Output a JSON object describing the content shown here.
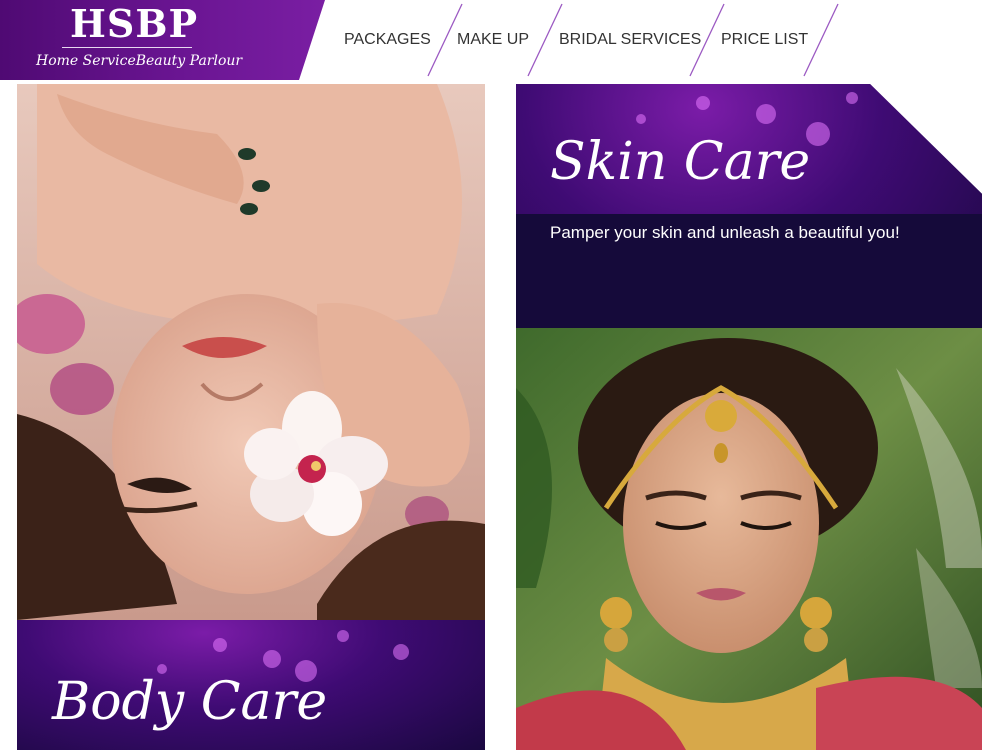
{
  "brand": {
    "logo_text": "HSBP",
    "tagline": "Home ServiceBeauty Parlour",
    "color_primary": "#5a0f84"
  },
  "nav": {
    "items": [
      {
        "label": "PACKAGES"
      },
      {
        "label": "MAKE UP"
      },
      {
        "label": "BRIDAL SERVICES"
      },
      {
        "label": "PRICE LIST"
      }
    ]
  },
  "cards": {
    "body_care": {
      "title": "Body Care",
      "image": "woman-lying-with-flowers-photo"
    },
    "skin_care": {
      "title": "Skin Care",
      "subtitle": "Pamper your skin and unleash a beautiful you!",
      "image": "bride-with-gold-jewellery-photo"
    }
  }
}
